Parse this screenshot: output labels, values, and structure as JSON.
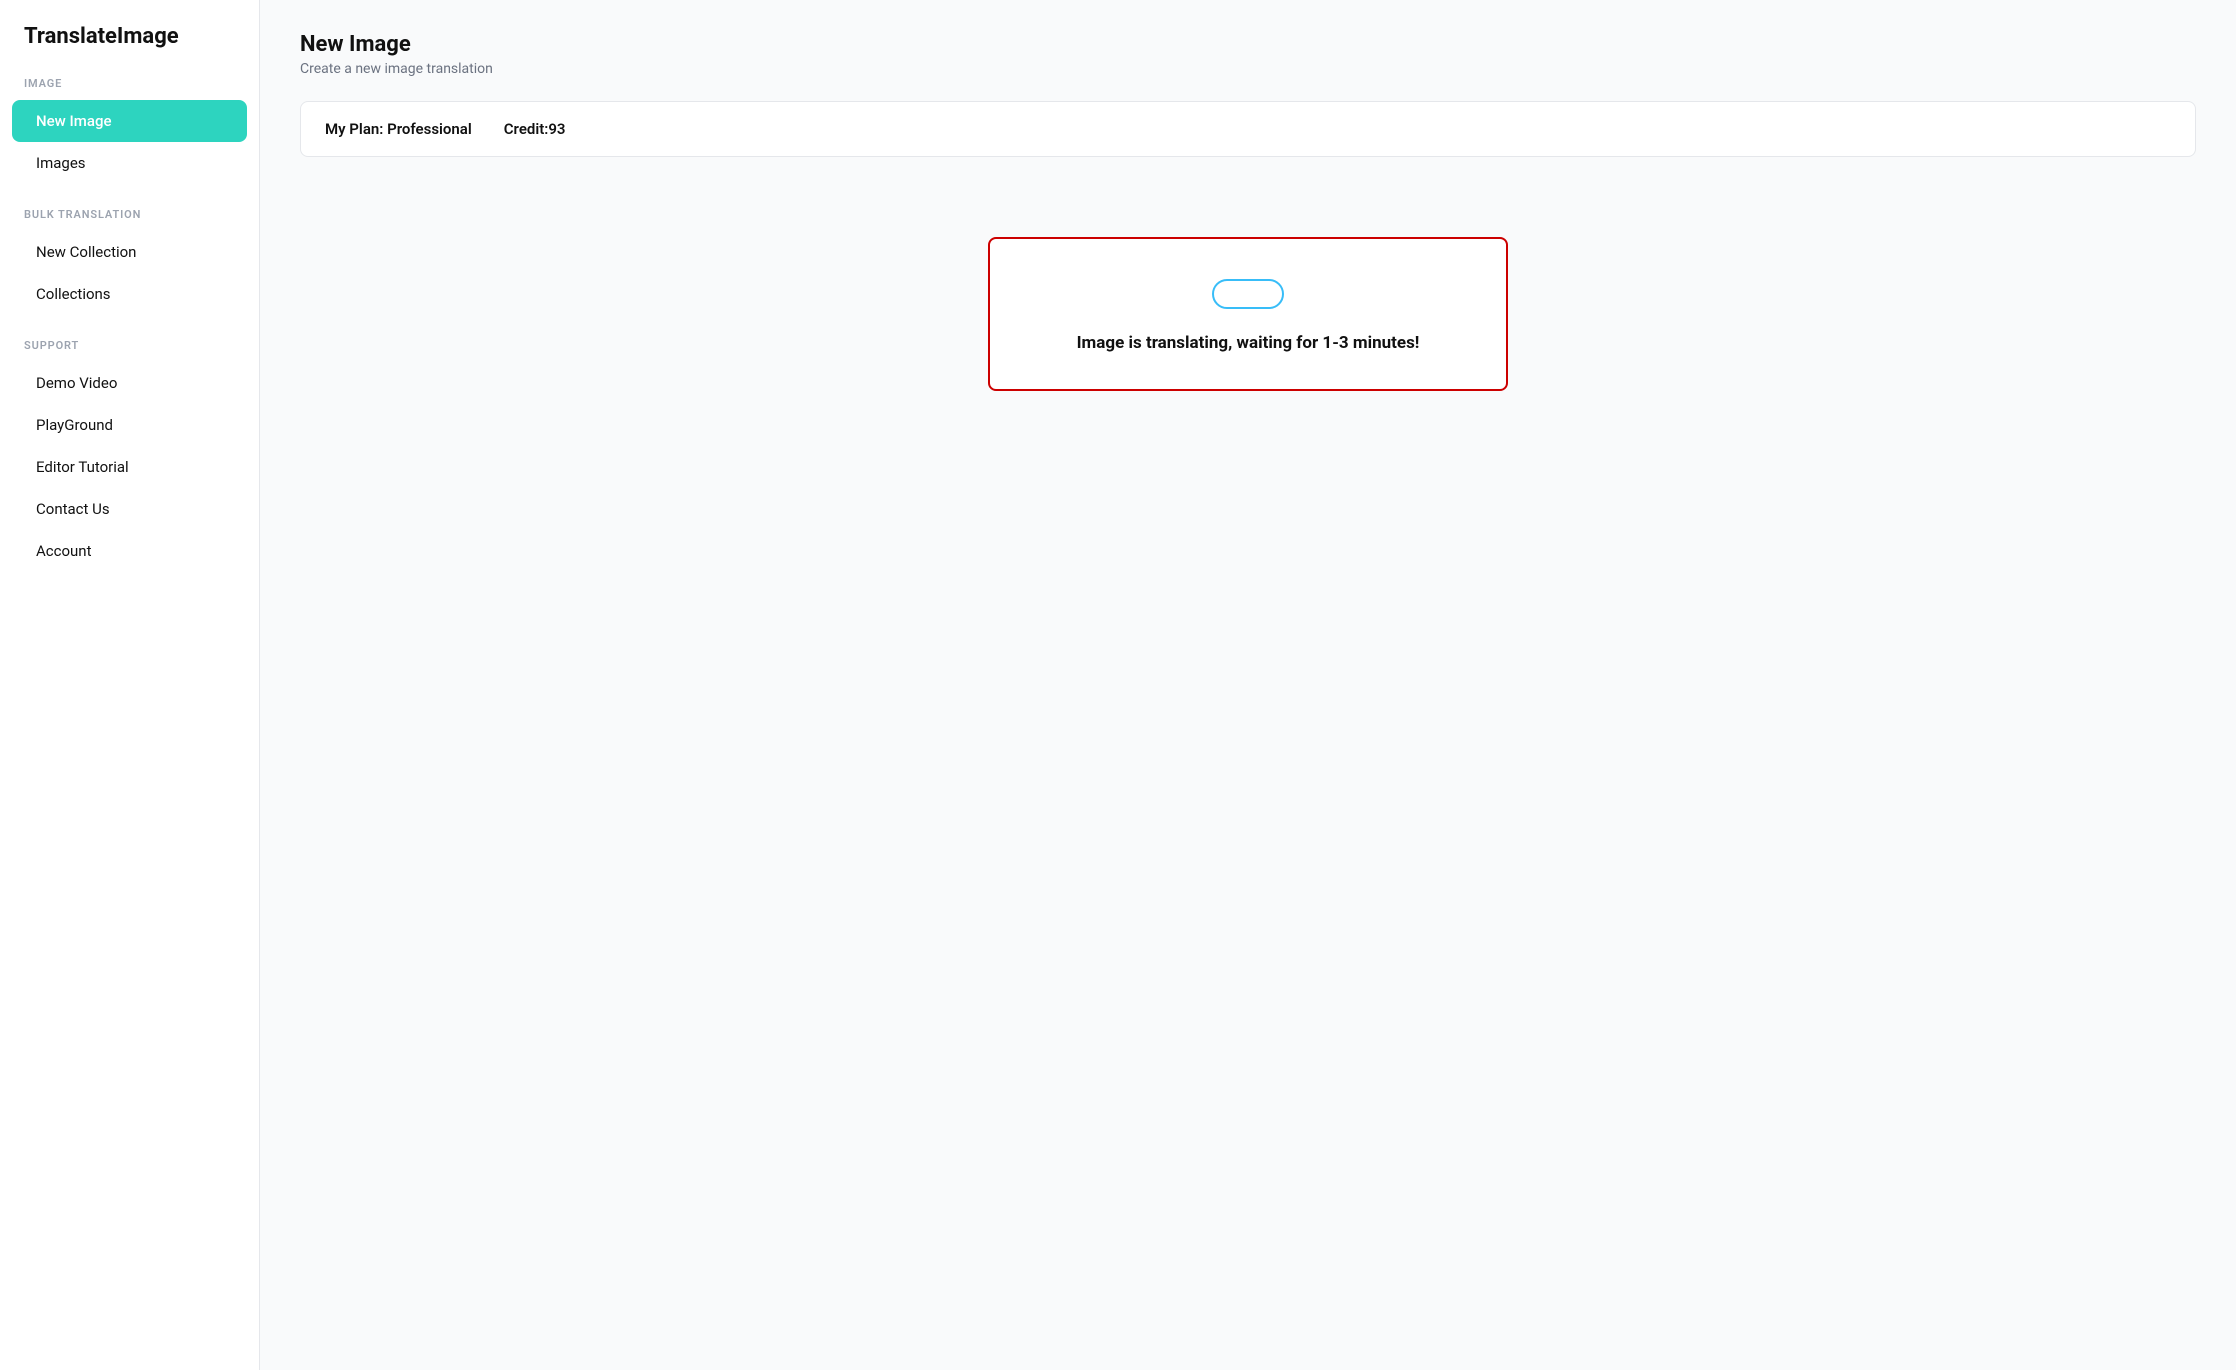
{
  "app": {
    "logo": "TranslateImage"
  },
  "sidebar": {
    "sections": [
      {
        "label": "IMAGE",
        "items": [
          {
            "id": "new-image",
            "label": "New Image",
            "active": true
          },
          {
            "id": "images",
            "label": "Images",
            "active": false
          }
        ]
      },
      {
        "label": "BULK TRANSLATION",
        "items": [
          {
            "id": "new-collection",
            "label": "New Collection",
            "active": false
          },
          {
            "id": "collections",
            "label": "Collections",
            "active": false
          }
        ]
      },
      {
        "label": "SUPPORT",
        "items": [
          {
            "id": "demo-video",
            "label": "Demo Video",
            "active": false
          },
          {
            "id": "playground",
            "label": "PlayGround",
            "active": false
          },
          {
            "id": "editor-tutorial",
            "label": "Editor Tutorial",
            "active": false
          },
          {
            "id": "contact-us",
            "label": "Contact Us",
            "active": false
          },
          {
            "id": "account",
            "label": "Account",
            "active": false
          }
        ]
      }
    ]
  },
  "main": {
    "page_title": "New Image",
    "page_subtitle": "Create a new image translation",
    "plan_label": "My Plan: Professional",
    "credit_label": "Credit:93",
    "status_message": "Image is translating, waiting for 1-3 minutes!"
  }
}
